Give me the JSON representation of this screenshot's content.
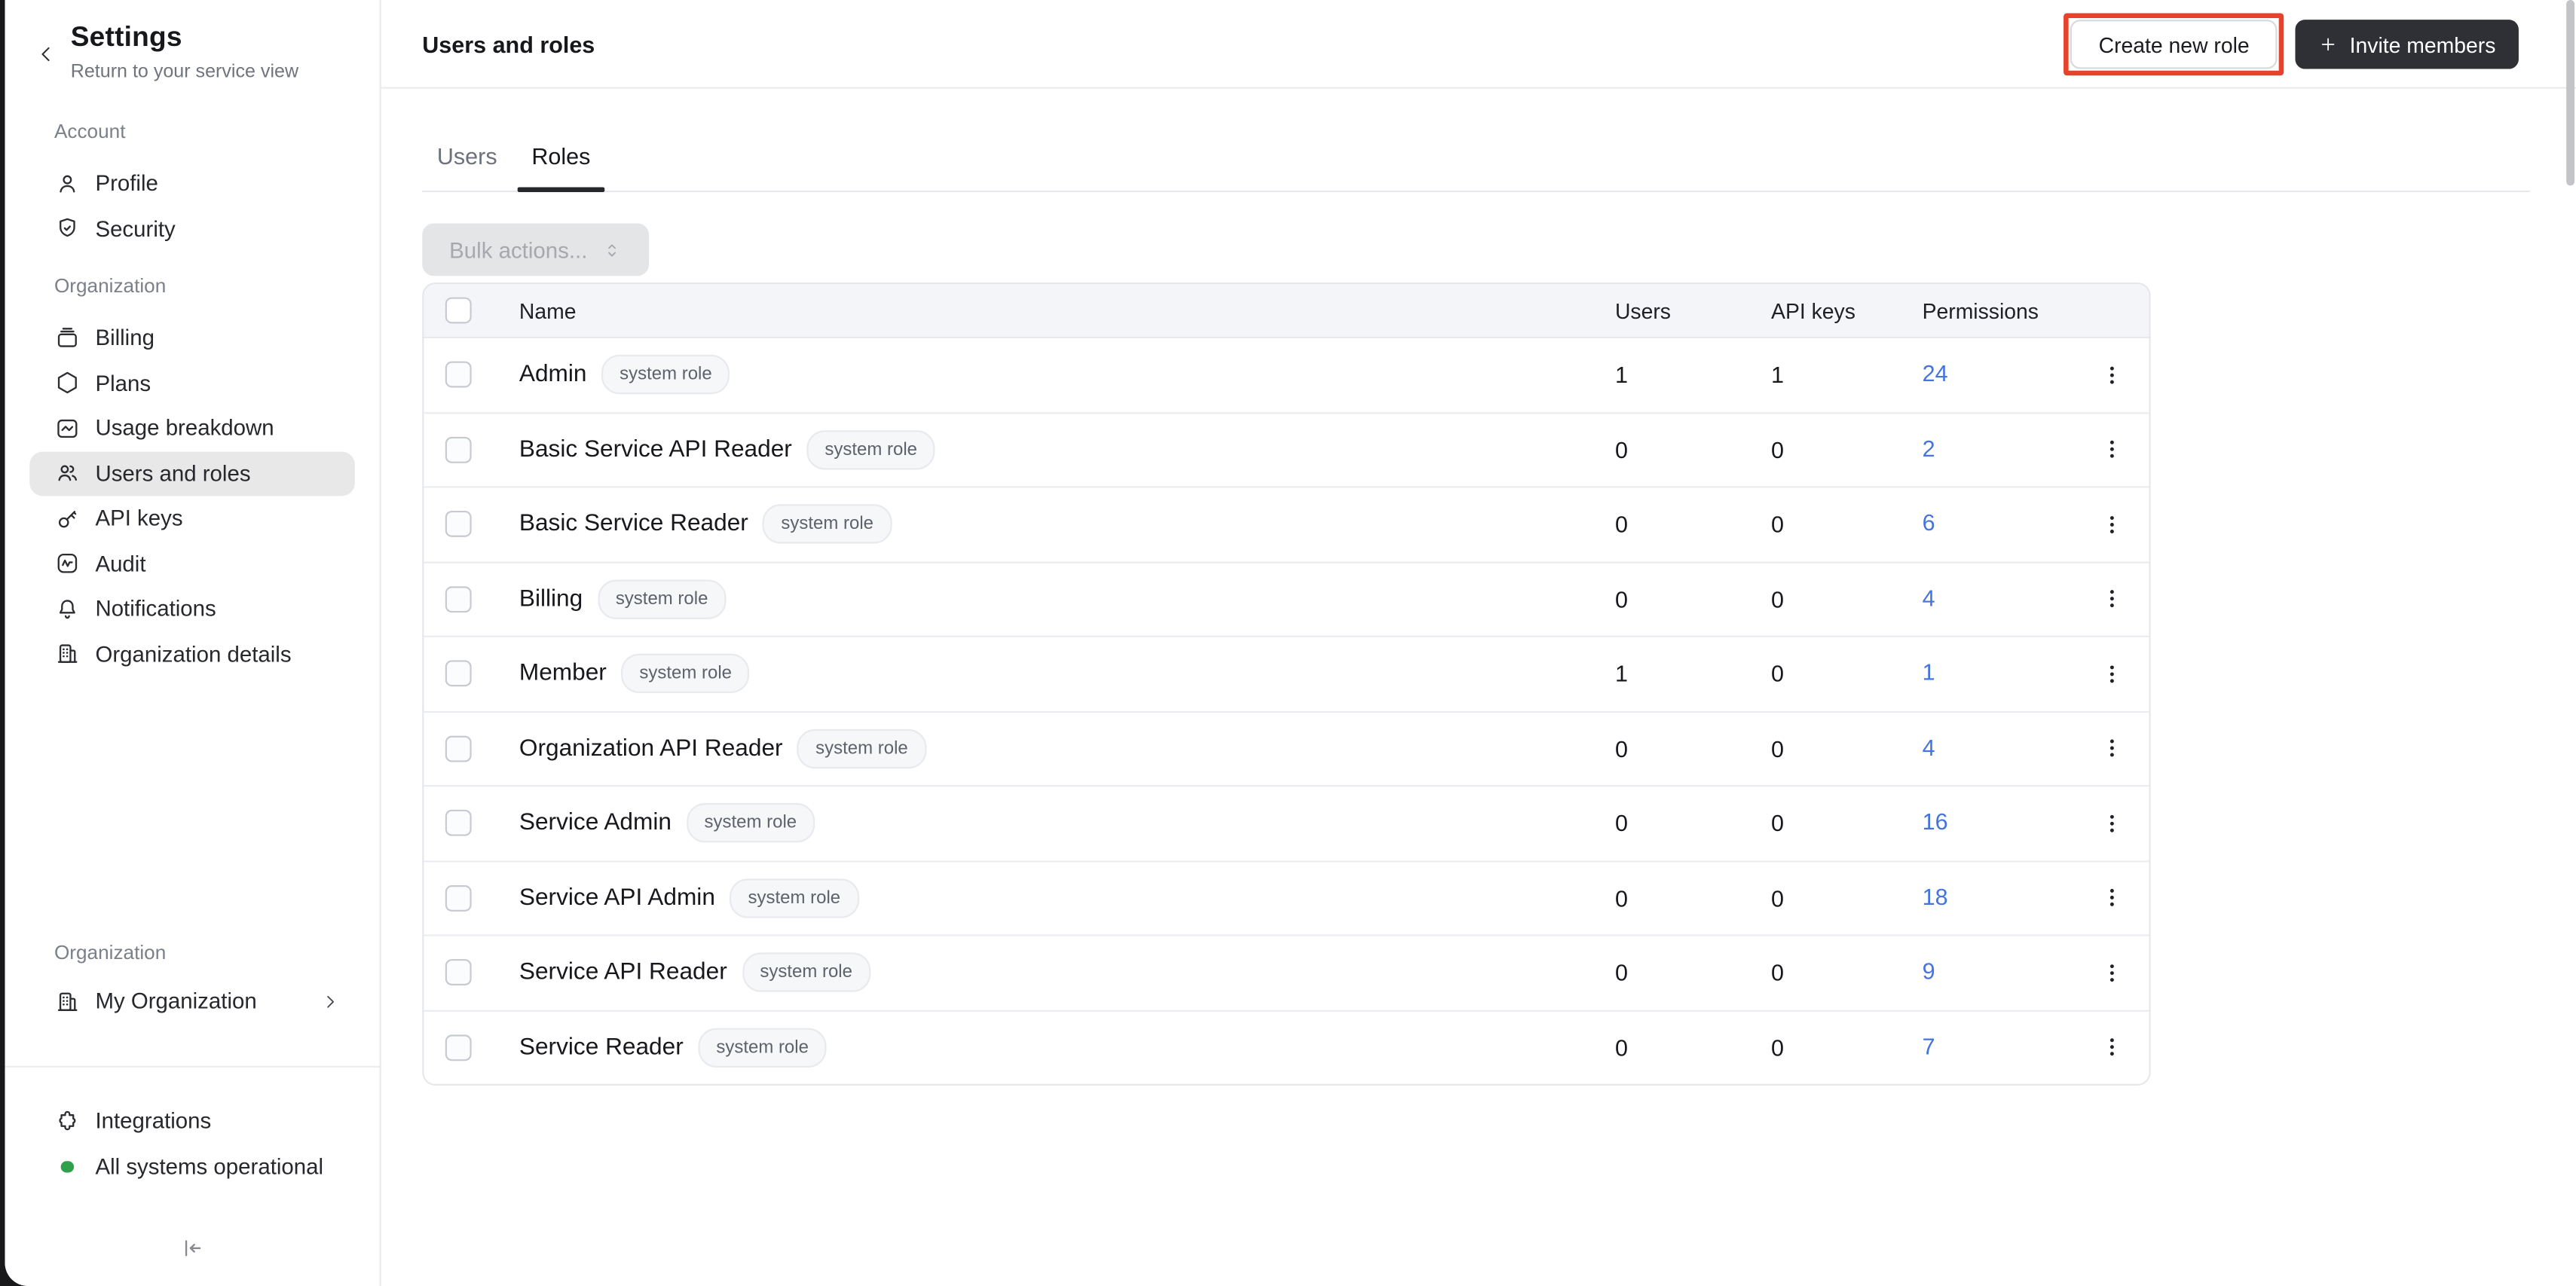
{
  "colors": {
    "accent_red": "#E7422C",
    "link_blue": "#4374E0",
    "status_green": "#2FA14B",
    "btn_dark": "#2F3035",
    "selected_bg": "#E8E8E9"
  },
  "sidebar": {
    "back_icon": "chevron-left-icon",
    "title": "Settings",
    "subtitle": "Return to your service view",
    "sections": [
      {
        "label": "Account",
        "items": [
          {
            "label": "Profile",
            "icon": "user-icon"
          },
          {
            "label": "Security",
            "icon": "shield-check-icon"
          }
        ]
      },
      {
        "label": "Organization",
        "items": [
          {
            "label": "Billing",
            "icon": "billing-icon"
          },
          {
            "label": "Plans",
            "icon": "hexagon-icon"
          },
          {
            "label": "Usage breakdown",
            "icon": "usage-chart-icon"
          },
          {
            "label": "Users and roles",
            "icon": "users-icon",
            "selected": true
          },
          {
            "label": "API keys",
            "icon": "key-icon"
          },
          {
            "label": "Audit",
            "icon": "audit-icon"
          },
          {
            "label": "Notifications",
            "icon": "bell-icon"
          },
          {
            "label": "Organization details",
            "icon": "building-icon"
          }
        ]
      }
    ],
    "org_switcher": {
      "label": "Organization",
      "item": {
        "label": "My Organization",
        "icon": "building-icon",
        "chevron": "chevron-right-icon"
      }
    },
    "footer": {
      "integrations_label": "Integrations",
      "integrations_icon": "puzzle-icon",
      "status_label": "All systems operational"
    }
  },
  "header": {
    "title": "Users and roles",
    "create_role_label": "Create new role",
    "invite_label": "Invite members",
    "invite_icon": "plus-icon"
  },
  "tabs": [
    {
      "label": "Users",
      "active": false
    },
    {
      "label": "Roles",
      "active": true
    }
  ],
  "toolbar": {
    "bulk_actions_label": "Bulk actions...",
    "disabled": true
  },
  "table": {
    "columns": [
      "Name",
      "Users",
      "API keys",
      "Permissions"
    ],
    "badge_label": "system role",
    "rows": [
      {
        "name": "Admin",
        "users": "1",
        "api_keys": "1",
        "permissions": "24"
      },
      {
        "name": "Basic Service API Reader",
        "users": "0",
        "api_keys": "0",
        "permissions": "2"
      },
      {
        "name": "Basic Service Reader",
        "users": "0",
        "api_keys": "0",
        "permissions": "6"
      },
      {
        "name": "Billing",
        "users": "0",
        "api_keys": "0",
        "permissions": "4"
      },
      {
        "name": "Member",
        "users": "1",
        "api_keys": "0",
        "permissions": "1"
      },
      {
        "name": "Organization API Reader",
        "users": "0",
        "api_keys": "0",
        "permissions": "4"
      },
      {
        "name": "Service Admin",
        "users": "0",
        "api_keys": "0",
        "permissions": "16"
      },
      {
        "name": "Service API Admin",
        "users": "0",
        "api_keys": "0",
        "permissions": "18"
      },
      {
        "name": "Service API Reader",
        "users": "0",
        "api_keys": "0",
        "permissions": "9"
      },
      {
        "name": "Service Reader",
        "users": "0",
        "api_keys": "0",
        "permissions": "7"
      }
    ]
  }
}
